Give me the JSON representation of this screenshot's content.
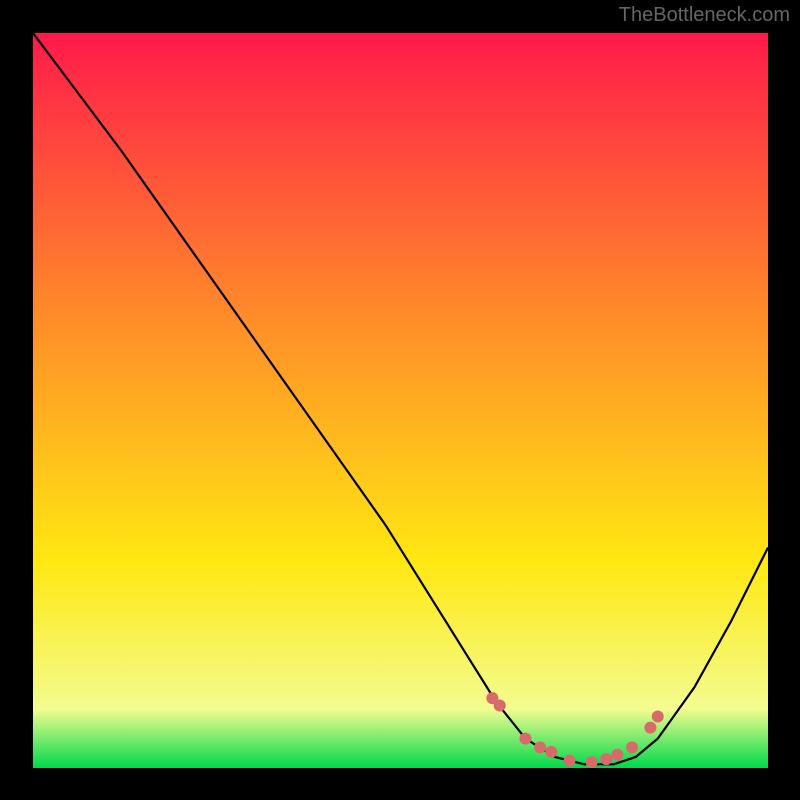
{
  "watermark": "TheBottleneck.com",
  "chart_data": {
    "type": "line",
    "title": "",
    "xlabel": "",
    "ylabel": "",
    "xlim": [
      0,
      100
    ],
    "ylim": [
      0,
      100
    ],
    "gradient_colors": {
      "top": "#ff1a4a",
      "upper_mid": "#ff8a2a",
      "lower_mid": "#ffe812",
      "near_bottom": "#f3fc90",
      "bottom": "#00d94a"
    },
    "curve": {
      "name": "bottleneck-curve",
      "color": "#000000",
      "x": [
        0,
        12,
        24,
        36,
        48,
        58,
        63,
        67,
        71,
        75,
        79,
        82,
        85,
        90,
        95,
        100
      ],
      "y": [
        100,
        84,
        67,
        50,
        33,
        17,
        9,
        4,
        1.5,
        0.5,
        0.5,
        1.5,
        4,
        11,
        20,
        30
      ]
    },
    "markers": {
      "name": "bottleneck-points",
      "color": "#d96a6a",
      "x": [
        62.5,
        63.5,
        67,
        69,
        70.5,
        73,
        76,
        78,
        79.5,
        81.5,
        84,
        85
      ],
      "y": [
        9.5,
        8.5,
        4,
        2.8,
        2.2,
        1.0,
        0.8,
        1.2,
        1.8,
        2.8,
        5.5,
        7
      ]
    }
  }
}
